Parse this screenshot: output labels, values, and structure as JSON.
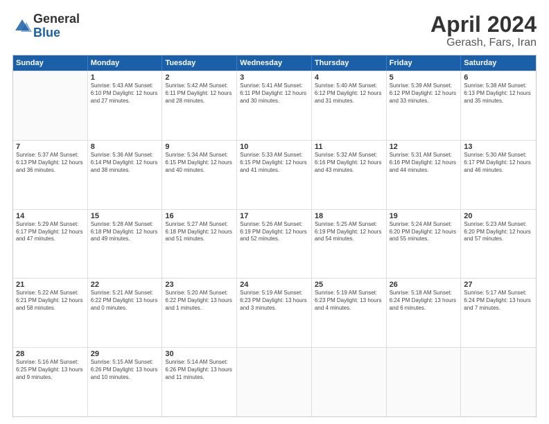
{
  "header": {
    "logo_general": "General",
    "logo_blue": "Blue",
    "month": "April 2024",
    "location": "Gerash, Fars, Iran"
  },
  "weekdays": [
    "Sunday",
    "Monday",
    "Tuesday",
    "Wednesday",
    "Thursday",
    "Friday",
    "Saturday"
  ],
  "weeks": [
    [
      {
        "day": "",
        "info": ""
      },
      {
        "day": "1",
        "info": "Sunrise: 5:43 AM\nSunset: 6:10 PM\nDaylight: 12 hours\nand 27 minutes."
      },
      {
        "day": "2",
        "info": "Sunrise: 5:42 AM\nSunset: 6:11 PM\nDaylight: 12 hours\nand 28 minutes."
      },
      {
        "day": "3",
        "info": "Sunrise: 5:41 AM\nSunset: 6:11 PM\nDaylight: 12 hours\nand 30 minutes."
      },
      {
        "day": "4",
        "info": "Sunrise: 5:40 AM\nSunset: 6:12 PM\nDaylight: 12 hours\nand 31 minutes."
      },
      {
        "day": "5",
        "info": "Sunrise: 5:39 AM\nSunset: 6:12 PM\nDaylight: 12 hours\nand 33 minutes."
      },
      {
        "day": "6",
        "info": "Sunrise: 5:38 AM\nSunset: 6:13 PM\nDaylight: 12 hours\nand 35 minutes."
      }
    ],
    [
      {
        "day": "7",
        "info": "Sunrise: 5:37 AM\nSunset: 6:13 PM\nDaylight: 12 hours\nand 36 minutes."
      },
      {
        "day": "8",
        "info": "Sunrise: 5:36 AM\nSunset: 6:14 PM\nDaylight: 12 hours\nand 38 minutes."
      },
      {
        "day": "9",
        "info": "Sunrise: 5:34 AM\nSunset: 6:15 PM\nDaylight: 12 hours\nand 40 minutes."
      },
      {
        "day": "10",
        "info": "Sunrise: 5:33 AM\nSunset: 6:15 PM\nDaylight: 12 hours\nand 41 minutes."
      },
      {
        "day": "11",
        "info": "Sunrise: 5:32 AM\nSunset: 6:16 PM\nDaylight: 12 hours\nand 43 minutes."
      },
      {
        "day": "12",
        "info": "Sunrise: 5:31 AM\nSunset: 6:16 PM\nDaylight: 12 hours\nand 44 minutes."
      },
      {
        "day": "13",
        "info": "Sunrise: 5:30 AM\nSunset: 6:17 PM\nDaylight: 12 hours\nand 46 minutes."
      }
    ],
    [
      {
        "day": "14",
        "info": "Sunrise: 5:29 AM\nSunset: 6:17 PM\nDaylight: 12 hours\nand 47 minutes."
      },
      {
        "day": "15",
        "info": "Sunrise: 5:28 AM\nSunset: 6:18 PM\nDaylight: 12 hours\nand 49 minutes."
      },
      {
        "day": "16",
        "info": "Sunrise: 5:27 AM\nSunset: 6:18 PM\nDaylight: 12 hours\nand 51 minutes."
      },
      {
        "day": "17",
        "info": "Sunrise: 5:26 AM\nSunset: 6:19 PM\nDaylight: 12 hours\nand 52 minutes."
      },
      {
        "day": "18",
        "info": "Sunrise: 5:25 AM\nSunset: 6:19 PM\nDaylight: 12 hours\nand 54 minutes."
      },
      {
        "day": "19",
        "info": "Sunrise: 5:24 AM\nSunset: 6:20 PM\nDaylight: 12 hours\nand 55 minutes."
      },
      {
        "day": "20",
        "info": "Sunrise: 5:23 AM\nSunset: 6:20 PM\nDaylight: 12 hours\nand 57 minutes."
      }
    ],
    [
      {
        "day": "21",
        "info": "Sunrise: 5:22 AM\nSunset: 6:21 PM\nDaylight: 12 hours\nand 58 minutes."
      },
      {
        "day": "22",
        "info": "Sunrise: 5:21 AM\nSunset: 6:22 PM\nDaylight: 13 hours\nand 0 minutes."
      },
      {
        "day": "23",
        "info": "Sunrise: 5:20 AM\nSunset: 6:22 PM\nDaylight: 13 hours\nand 1 minutes."
      },
      {
        "day": "24",
        "info": "Sunrise: 5:19 AM\nSunset: 6:23 PM\nDaylight: 13 hours\nand 3 minutes."
      },
      {
        "day": "25",
        "info": "Sunrise: 5:19 AM\nSunset: 6:23 PM\nDaylight: 13 hours\nand 4 minutes."
      },
      {
        "day": "26",
        "info": "Sunrise: 5:18 AM\nSunset: 6:24 PM\nDaylight: 13 hours\nand 6 minutes."
      },
      {
        "day": "27",
        "info": "Sunrise: 5:17 AM\nSunset: 6:24 PM\nDaylight: 13 hours\nand 7 minutes."
      }
    ],
    [
      {
        "day": "28",
        "info": "Sunrise: 5:16 AM\nSunset: 6:25 PM\nDaylight: 13 hours\nand 9 minutes."
      },
      {
        "day": "29",
        "info": "Sunrise: 5:15 AM\nSunset: 6:26 PM\nDaylight: 13 hours\nand 10 minutes."
      },
      {
        "day": "30",
        "info": "Sunrise: 5:14 AM\nSunset: 6:26 PM\nDaylight: 13 hours\nand 11 minutes."
      },
      {
        "day": "",
        "info": ""
      },
      {
        "day": "",
        "info": ""
      },
      {
        "day": "",
        "info": ""
      },
      {
        "day": "",
        "info": ""
      }
    ]
  ]
}
